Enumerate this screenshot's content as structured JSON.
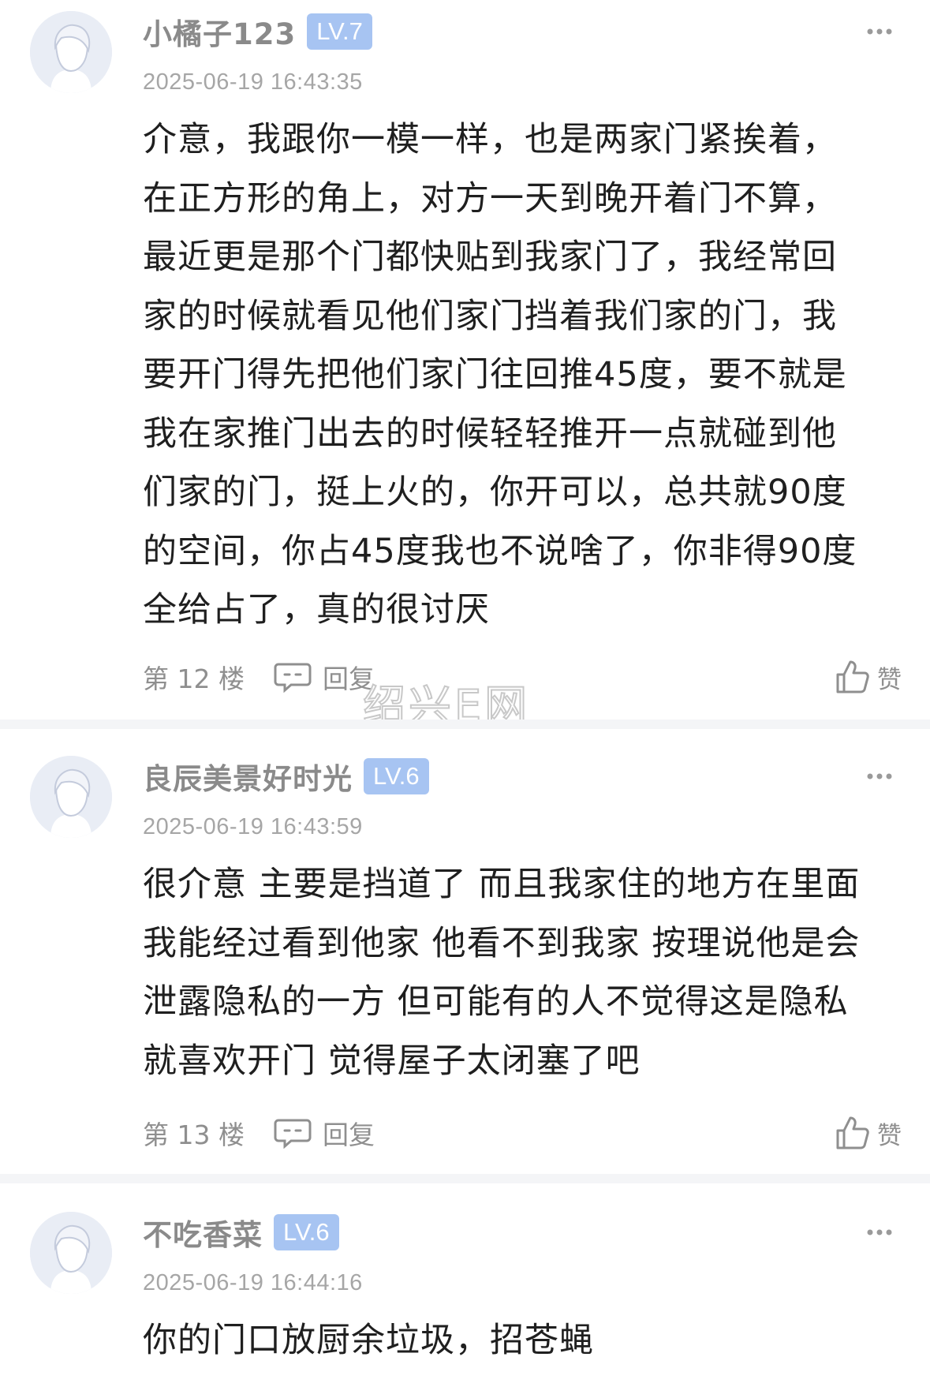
{
  "comments": [
    {
      "username": "小橘子123",
      "level": "LV.7",
      "timestamp": "2025-06-19 16:43:35",
      "content": "介意，我跟你一模一样，也是两家门紧挨着，\n在正方形的角上，对方一天到晚开着门不算，\n最近更是那个门都快贴到我家门了，我经常回\n家的时候就看见他们家门挡着我们家的门，我\n要开门得先把他们家门往回推45度，要不就是\n我在家推门出去的时候轻轻推开一点就碰到他\n们家的门，挺上火的，你开可以，总共就90度\n的空间，你占45度我也不说啥了，你非得90度\n全给占了，真的很讨厌",
      "floor": "第 12 楼",
      "reply_label": "回复",
      "like_label": "赞"
    },
    {
      "username": "良辰美景好时光",
      "level": "LV.6",
      "timestamp": "2025-06-19 16:43:59",
      "content": "很介意 主要是挡道了 而且我家住的地方在里面\n我能经过看到他家 他看不到我家 按理说他是会\n泄露隐私的一方 但可能有的人不觉得这是隐私\n就喜欢开门 觉得屋子太闭塞了吧",
      "floor": "第 13 楼",
      "reply_label": "回复",
      "like_label": "赞"
    },
    {
      "username": "不吃香菜",
      "level": "LV.6",
      "timestamp": "2025-06-19 16:44:16",
      "content": "你的门口放厨余垃圾，招苍蝇"
    }
  ],
  "watermark": "绍兴E网",
  "icons": {
    "avatar": "default-avatar-icon",
    "more": "more-dots-icon",
    "reply": "comment-bubble-icon",
    "like": "thumbs-up-icon"
  },
  "colors": {
    "level_badge": "#a7c4f2",
    "username": "#8a8a8a",
    "timestamp": "#a6a6a6",
    "content": "#1f1f1f",
    "divider": "#f4f5f7"
  }
}
